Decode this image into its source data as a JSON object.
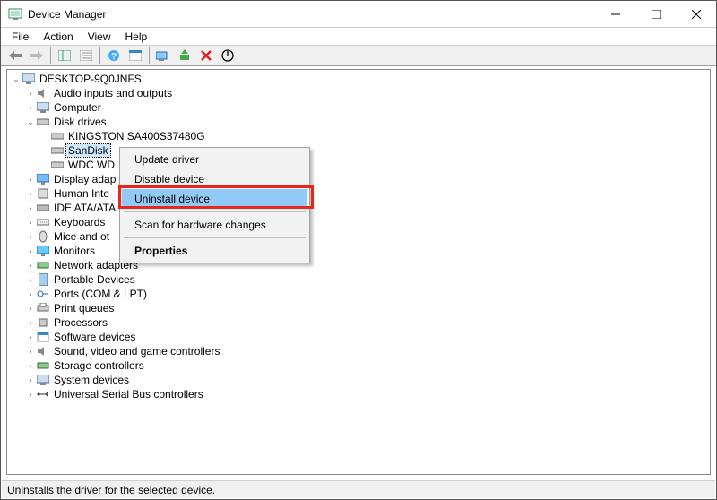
{
  "window": {
    "title": "Device Manager"
  },
  "menus": {
    "file": "File",
    "action": "Action",
    "view": "View",
    "help": "Help"
  },
  "tree": {
    "root": "DESKTOP-9Q0JNFS",
    "cat_audio": "Audio inputs and outputs",
    "cat_computer": "Computer",
    "cat_disk": "Disk drives",
    "disk_kingston": "KINGSTON SA400S37480G",
    "disk_sandisk": "SanDisk",
    "disk_wdc": "WDC WD",
    "cat_display": "Display adap",
    "cat_hid": "Human Inte",
    "cat_ide": "IDE ATA/ATA",
    "cat_keyboards": "Keyboards",
    "cat_mice": "Mice and ot",
    "cat_monitors": "Monitors",
    "cat_network": "Network adapters",
    "cat_portable": "Portable Devices",
    "cat_ports": "Ports (COM & LPT)",
    "cat_print": "Print queues",
    "cat_processors": "Processors",
    "cat_software": "Software devices",
    "cat_sound": "Sound, video and game controllers",
    "cat_storage": "Storage controllers",
    "cat_system": "System devices",
    "cat_usb": "Universal Serial Bus controllers"
  },
  "context_menu": {
    "update_driver": "Update driver",
    "disable_device": "Disable device",
    "uninstall_device": "Uninstall device",
    "scan_hardware": "Scan for hardware changes",
    "properties": "Properties"
  },
  "status": {
    "text": "Uninstalls the driver for the selected device."
  }
}
